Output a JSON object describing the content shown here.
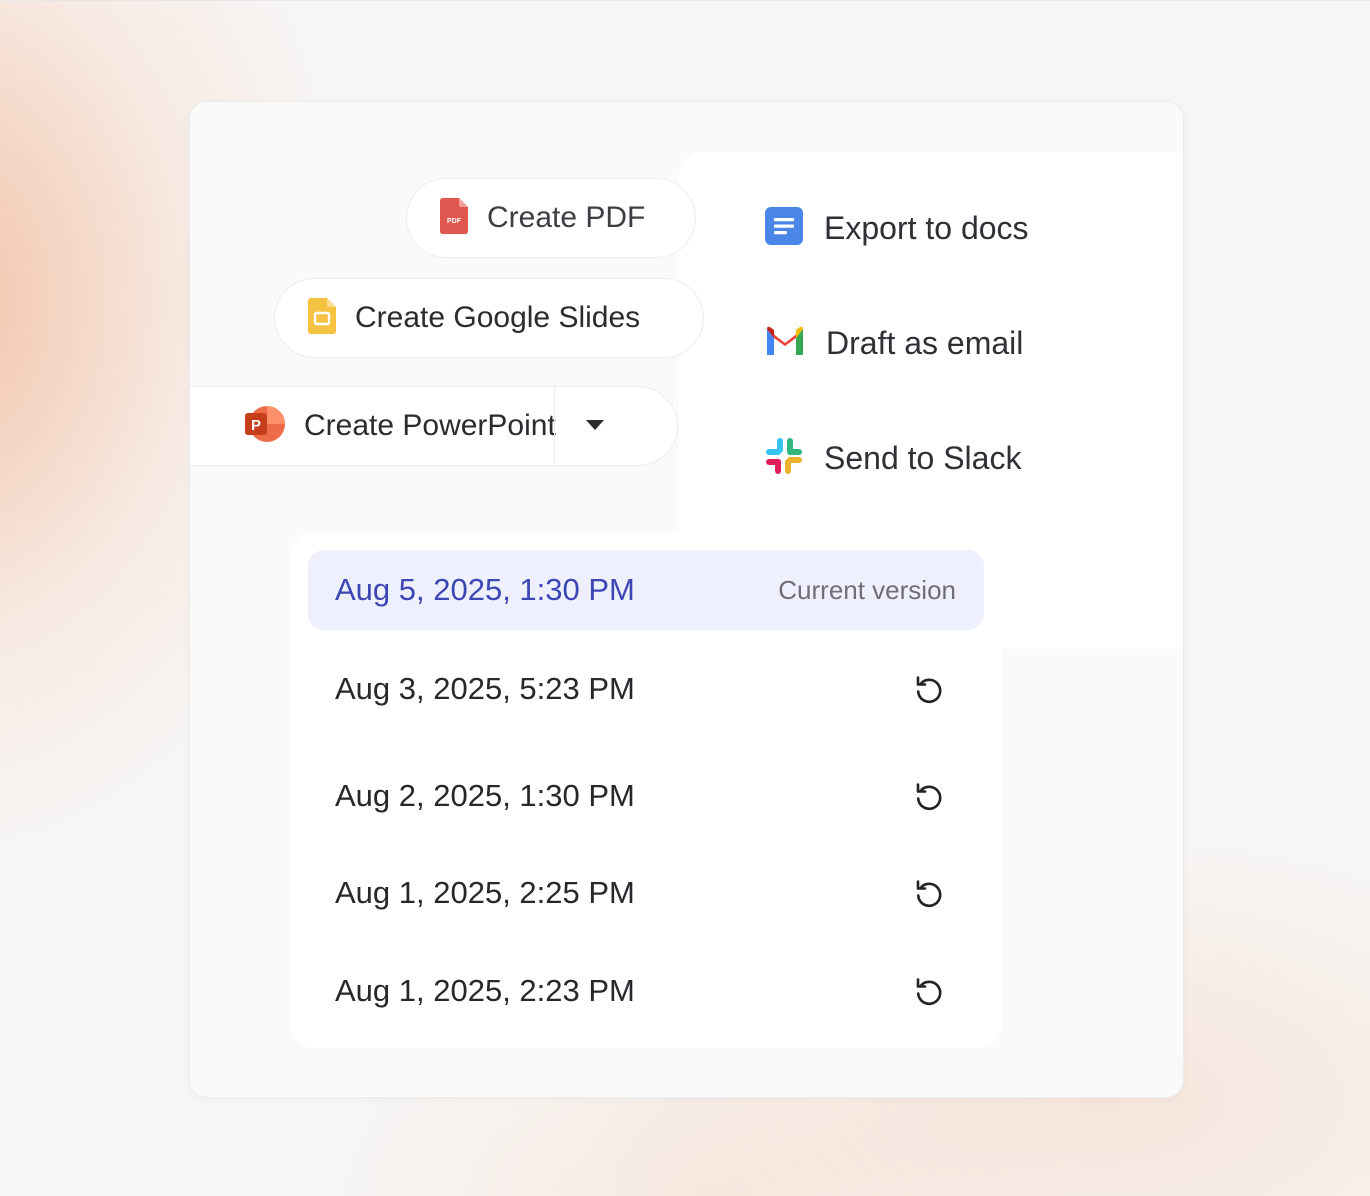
{
  "export_actions": [
    {
      "icon": "google-docs-icon",
      "label": "Export to docs"
    },
    {
      "icon": "gmail-icon",
      "label": "Draft as email"
    },
    {
      "icon": "slack-icon",
      "label": "Send to Slack"
    }
  ],
  "create_buttons": {
    "pdf": {
      "icon": "pdf-file-icon",
      "label": "Create PDF",
      "icon_text": "PDF"
    },
    "slides": {
      "icon": "google-slides-icon",
      "label": "Create Google Slides"
    },
    "powerpoint": {
      "icon": "powerpoint-icon",
      "label": "Create PowerPoint",
      "icon_text": "P"
    }
  },
  "versions": [
    {
      "date": "Aug 5, 2025, 1:30 PM",
      "tag": "Current version",
      "current": true
    },
    {
      "date": "Aug 3, 2025, 5:23 PM",
      "current": false
    },
    {
      "date": "Aug 2, 2025, 1:30 PM",
      "current": false
    },
    {
      "date": "Aug 1, 2025, 2:25 PM",
      "current": false
    },
    {
      "date": "Aug 1, 2025, 2:23 PM",
      "current": false
    }
  ],
  "colors": {
    "current_version_text": "#3c46b5",
    "current_version_bg": "#eef1fd",
    "pdf_red": "#e0574f",
    "slides_yellow": "#f5c242",
    "docs_blue": "#4a86e8",
    "powerpoint_orange": "#d24726"
  }
}
